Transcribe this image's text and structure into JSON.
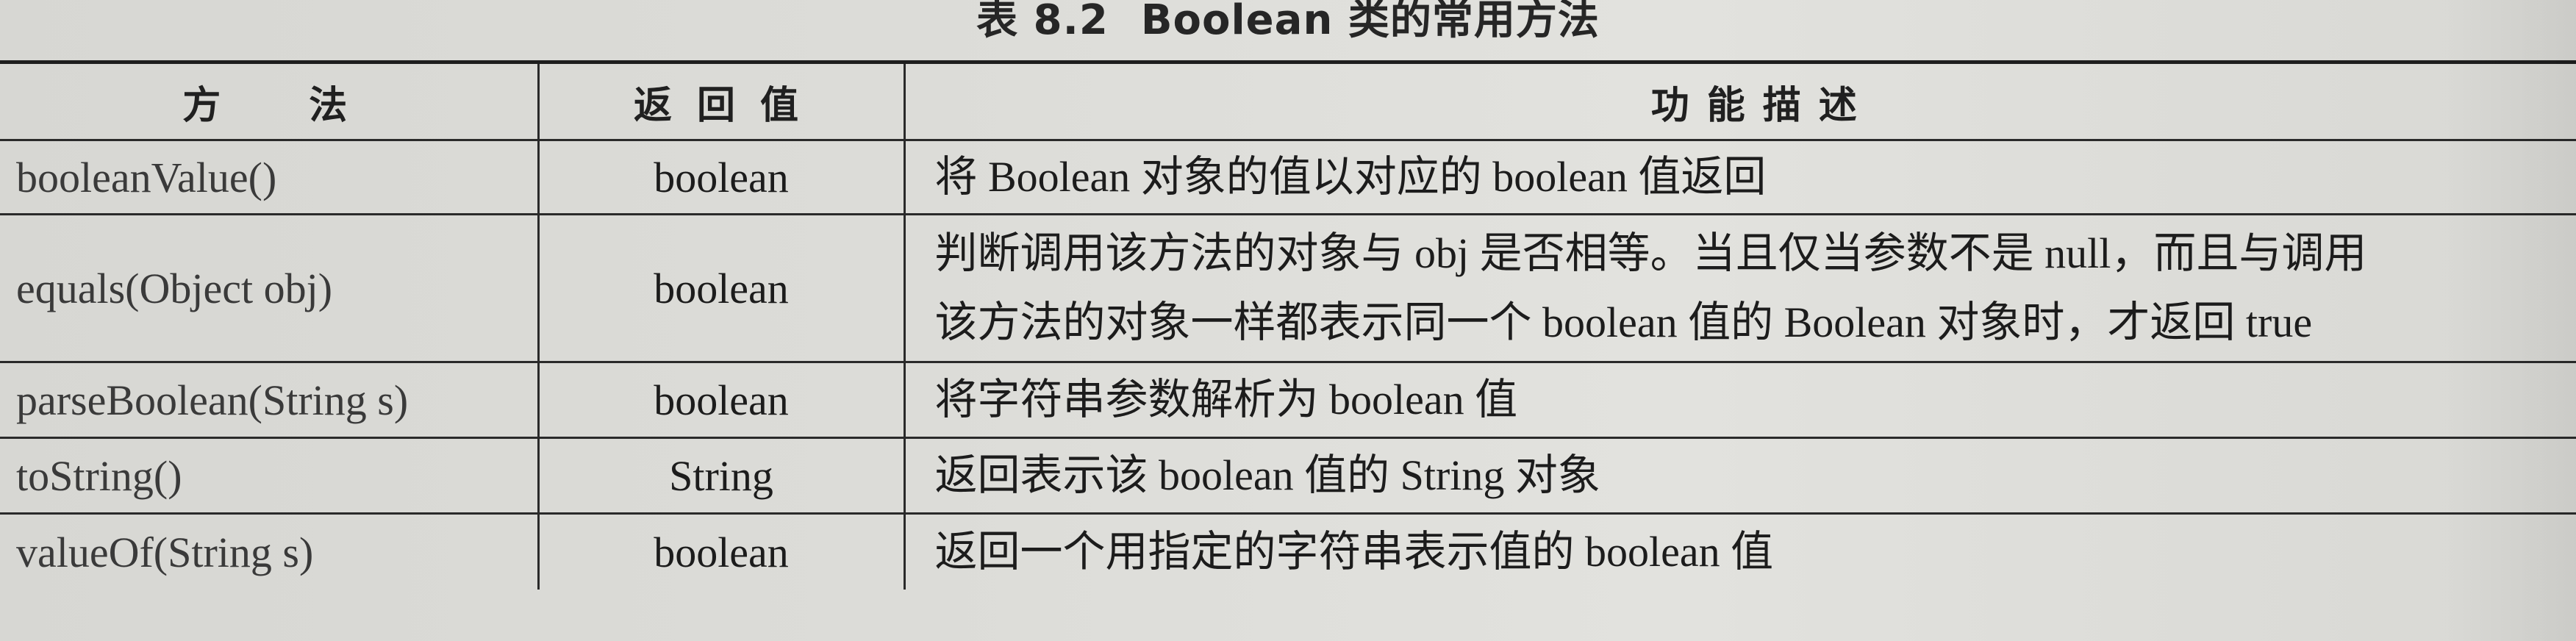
{
  "caption": {
    "number": "表 8.2",
    "title": "Boolean 类的常用方法"
  },
  "table": {
    "headers": {
      "method": "方法",
      "return": "返回值",
      "description": "功能描述"
    },
    "rows": [
      {
        "method": "booleanValue()",
        "return": "boolean",
        "description": [
          "将 Boolean 对象的值以对应的 boolean 值返回"
        ]
      },
      {
        "method": "equals(Object obj)",
        "return": "boolean",
        "description": [
          "判断调用该方法的对象与 obj 是否相等。当且仅当参数不是 null，而且与调用",
          "该方法的对象一样都表示同一个 boolean 值的 Boolean 对象时，才返回 true"
        ]
      },
      {
        "method": "parseBoolean(String s)",
        "return": "boolean",
        "description": [
          "将字符串参数解析为 boolean 值"
        ]
      },
      {
        "method": "toString()",
        "return": "String",
        "description": [
          "返回表示该 boolean 值的 String 对象"
        ]
      },
      {
        "method": "valueOf(String s)",
        "return": "boolean",
        "description": [
          "返回一个用指定的字符串表示值的 boolean 值"
        ]
      }
    ]
  }
}
